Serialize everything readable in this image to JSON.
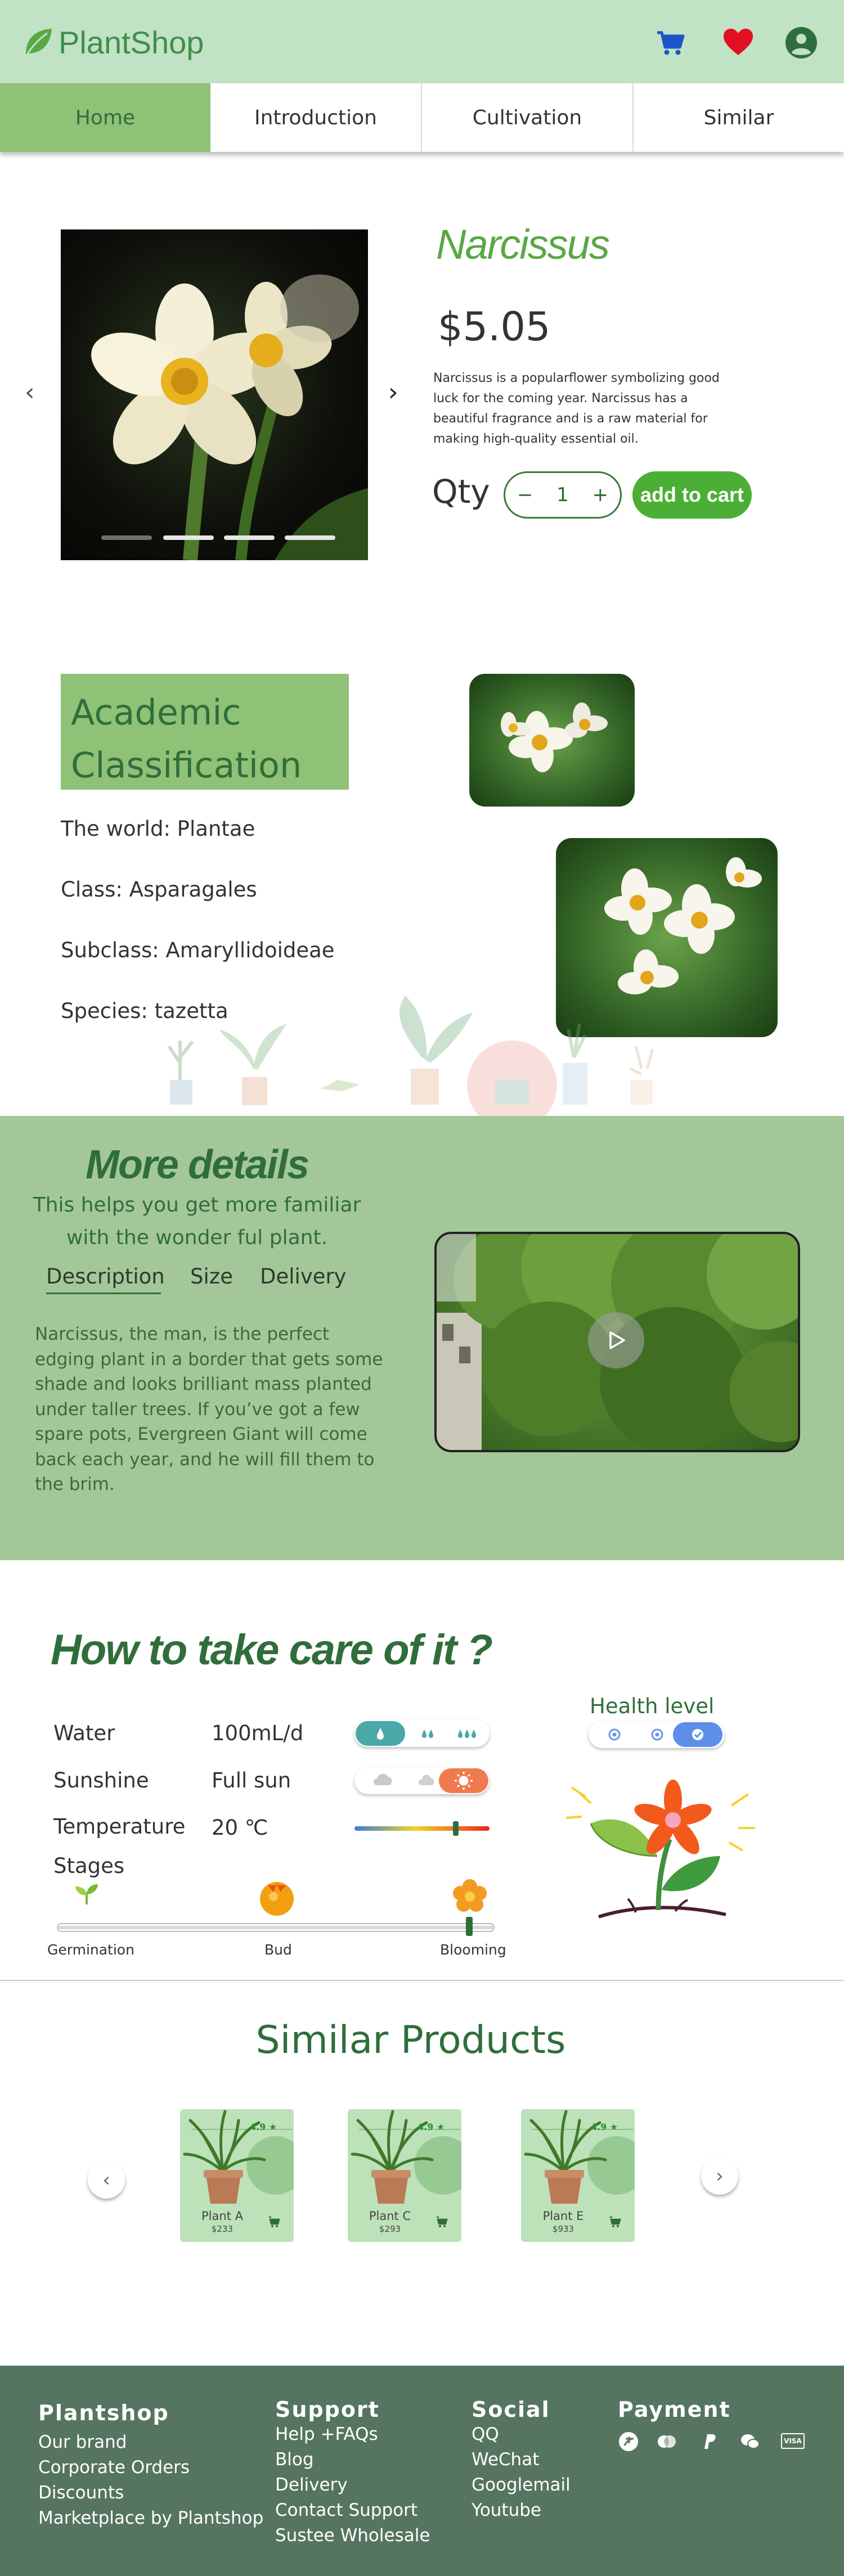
{
  "header": {
    "logo_text": "PlantShop",
    "icons": [
      "cart-icon",
      "heart-icon",
      "user-account-icon"
    ]
  },
  "nav": {
    "tabs": [
      {
        "label": "Home",
        "active": true
      },
      {
        "label": "Introduction",
        "active": false
      },
      {
        "label": "Cultivation",
        "active": false
      },
      {
        "label": "Similar",
        "active": false
      }
    ]
  },
  "product": {
    "name": "Narcissus",
    "price": "$5.05",
    "description": "Narcissus is a popularflower symbolizing good luck for the coming year. Narcissus has a beautiful fragrance and is a raw material for making high-quality essential oil.",
    "qty_label": "Qty",
    "qty_minus": "−",
    "qty_value": "1",
    "qty_plus": "+",
    "add_to_cart": "add to cart",
    "carousel_slides": 4
  },
  "classification": {
    "title": "Academic Classification",
    "items": [
      "The world: Plantae",
      "Class: Asparagales",
      "Subclass: Amaryllidoideae",
      "Species: tazetta"
    ]
  },
  "details": {
    "title": "More details",
    "subtitle": "This helps you get more familiar with the wonder ful plant.",
    "tabs": [
      "Description",
      "Size",
      "Delivery"
    ],
    "active_tab": "Description",
    "text": "Narcissus, the man, is the perfect edging plant in a border that gets some shade and looks brilliant mass planted under taller trees. If you’ve got a few spare pots, Evergreen Giant will come back each year, and he will fill them to the brim."
  },
  "care": {
    "title": "How to take care of it ?",
    "rows": [
      {
        "label": "Water",
        "value": "100mL/d"
      },
      {
        "label": "Sunshine",
        "value": "Full sun"
      },
      {
        "label": "Temperature",
        "value": "20 ℃"
      }
    ],
    "water_level_selected": 1,
    "water_level_total": 3,
    "sunshine_selected": 3,
    "sunshine_total": 3,
    "temperature_fraction": 0.75,
    "health_label": "Health level",
    "health_selected": 3,
    "health_total": 3,
    "stages_label": "Stages",
    "stages": [
      "Germination",
      "Bud",
      "Blooming"
    ],
    "current_stage": "Blooming"
  },
  "similar": {
    "title": "Similar Products",
    "products": [
      {
        "name": "Plant A",
        "price": "$233",
        "rating": "4.9 ★"
      },
      {
        "name": "Plant C",
        "price": "$293",
        "rating": "4.9 ★"
      },
      {
        "name": "Plant E",
        "price": "$933",
        "rating": "4.9 ★"
      }
    ]
  },
  "footer": {
    "columns": [
      {
        "heading": "Plantshop",
        "items": [
          "Our brand",
          "Corporate Orders",
          "Discounts",
          "Marketplace by Plantshop"
        ]
      },
      {
        "heading": "Support",
        "items": [
          "Help +FAQs",
          "Blog",
          "Delivery",
          "Contact Support",
          "Sustee Wholesale"
        ]
      },
      {
        "heading": "Social",
        "items": [
          "QQ",
          "WeChat",
          "Googlemail",
          "Youtube"
        ]
      },
      {
        "heading": "Payment",
        "items": []
      }
    ],
    "payment_icons": [
      "alipay-icon",
      "mastercard-icon",
      "paypal-icon",
      "wechat-pay-icon",
      "visa-icon"
    ],
    "visa_text": "VISA"
  },
  "colors": {
    "header_bg": "#c1e2c4",
    "nav_active": "#8fc176",
    "brand_green": "#2f6e3b",
    "title_green": "#5aa845",
    "cart_button": "#4caf35",
    "details_bg": "#a4c79a",
    "footer_bg": "#557560"
  }
}
